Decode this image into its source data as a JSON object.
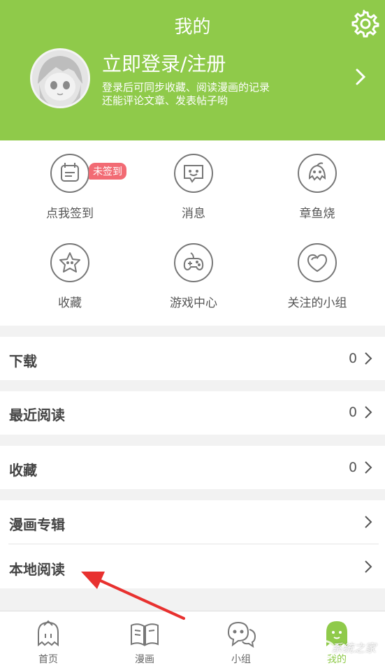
{
  "header": {
    "title": "我的",
    "login_title": "立即登录/注册",
    "login_sub_line1": "登录后可同步收藏、阅读漫画的记录",
    "login_sub_line2": "还能评论文章、发表帖子哟"
  },
  "grid": {
    "items": [
      {
        "label": "点我签到",
        "icon": "calendar-icon",
        "badge": "未签到"
      },
      {
        "label": "消息",
        "icon": "message-icon"
      },
      {
        "label": "章鱼烧",
        "icon": "takoyaki-icon"
      },
      {
        "label": "收藏",
        "icon": "star-icon"
      },
      {
        "label": "游戏中心",
        "icon": "gamepad-icon"
      },
      {
        "label": "关注的小组",
        "icon": "heart-icon"
      }
    ]
  },
  "list": {
    "download": {
      "label": "下载",
      "count": "0"
    },
    "recent": {
      "label": "最近阅读",
      "count": "0"
    },
    "favorites": {
      "label": "收藏",
      "count": "0"
    },
    "album": {
      "label": "漫画专辑"
    },
    "local": {
      "label": "本地阅读"
    }
  },
  "tabs": [
    {
      "label": "首页",
      "icon": "home-ghost-icon"
    },
    {
      "label": "漫画",
      "icon": "book-icon"
    },
    {
      "label": "小组",
      "icon": "chat-bubbles-icon"
    },
    {
      "label": "我的",
      "icon": "ghost-profile-icon",
      "active": true
    }
  ],
  "colors": {
    "brand": "#8fca4a",
    "badge": "#f26b74",
    "annotation_arrow": "#e8312f"
  },
  "watermark": "系统之家"
}
